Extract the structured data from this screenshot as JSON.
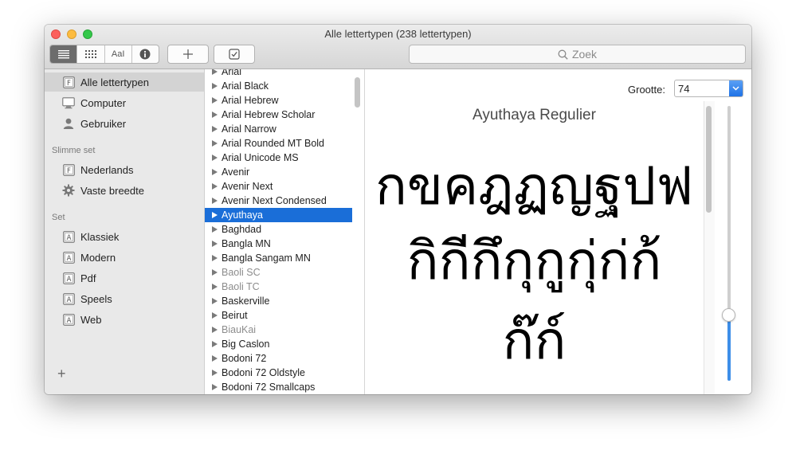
{
  "window": {
    "title": "Alle lettertypen (238 lettertypen)"
  },
  "toolbar": {
    "view_modes": [
      {
        "name": "list-view",
        "icon": "list-icon",
        "active": true
      },
      {
        "name": "grid-view",
        "icon": "grid-icon",
        "active": false
      },
      {
        "name": "sample-view",
        "icon": "text-sample-icon",
        "label": "AaI",
        "active": false
      },
      {
        "name": "info-view",
        "icon": "info-icon",
        "active": false
      }
    ],
    "add_icon": "plus-icon",
    "validate_icon": "checkbox-icon",
    "search_placeholder": "Zoek"
  },
  "sidebar": {
    "library_items": [
      {
        "label": "Alle lettertypen",
        "icon": "font-collection-icon",
        "selected": true
      },
      {
        "label": "Computer",
        "icon": "computer-icon",
        "selected": false
      },
      {
        "label": "Gebruiker",
        "icon": "user-icon",
        "selected": false
      }
    ],
    "smart_header": "Slimme set",
    "smart_items": [
      {
        "label": "Nederlands",
        "icon": "font-collection-icon"
      },
      {
        "label": "Vaste breedte",
        "icon": "gear-icon"
      }
    ],
    "set_header": "Set",
    "set_items": [
      {
        "label": "Klassiek",
        "icon": "font-set-icon"
      },
      {
        "label": "Modern",
        "icon": "font-set-icon"
      },
      {
        "label": "Pdf",
        "icon": "font-set-icon"
      },
      {
        "label": "Speels",
        "icon": "font-set-icon"
      },
      {
        "label": "Web",
        "icon": "font-set-icon"
      }
    ],
    "add_label": "+"
  },
  "fontlist": {
    "items": [
      {
        "label": "Arial",
        "dim": false
      },
      {
        "label": "Arial Black",
        "dim": false
      },
      {
        "label": "Arial Hebrew",
        "dim": false
      },
      {
        "label": "Arial Hebrew Scholar",
        "dim": false
      },
      {
        "label": "Arial Narrow",
        "dim": false
      },
      {
        "label": "Arial Rounded MT Bold",
        "dim": false
      },
      {
        "label": "Arial Unicode MS",
        "dim": false
      },
      {
        "label": "Avenir",
        "dim": false
      },
      {
        "label": "Avenir Next",
        "dim": false
      },
      {
        "label": "Avenir Next Condensed",
        "dim": false
      },
      {
        "label": "Ayuthaya",
        "dim": false,
        "selected": true
      },
      {
        "label": "Baghdad",
        "dim": false
      },
      {
        "label": "Bangla MN",
        "dim": false
      },
      {
        "label": "Bangla Sangam MN",
        "dim": false
      },
      {
        "label": "Baoli SC",
        "dim": true
      },
      {
        "label": "Baoli TC",
        "dim": true
      },
      {
        "label": "Baskerville",
        "dim": false
      },
      {
        "label": "Beirut",
        "dim": false
      },
      {
        "label": "BiauKai",
        "dim": true
      },
      {
        "label": "Big Caslon",
        "dim": false
      },
      {
        "label": "Bodoni 72",
        "dim": false
      },
      {
        "label": "Bodoni 72 Oldstyle",
        "dim": false
      },
      {
        "label": "Bodoni 72 Smallcaps",
        "dim": false
      }
    ]
  },
  "preview": {
    "size_label": "Grootte:",
    "size_value": "74",
    "font_name": "Ayuthaya Regulier",
    "sample_lines": [
      "กขคฎฏญฐปฟ",
      "กิกีกึกุกูกุ่ก่ก้",
      "ก๊ก์"
    ],
    "size_slider_fraction": 0.24
  }
}
